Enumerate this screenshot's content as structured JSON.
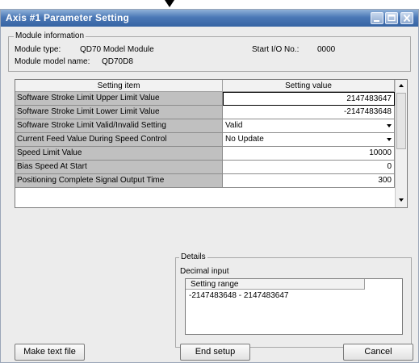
{
  "window": {
    "title": "Axis #1 Parameter Setting"
  },
  "module_info": {
    "legend": "Module information",
    "type_label": "Module type:",
    "type_value": "QD70 Model Module",
    "start_io_label": "Start I/O No.:",
    "start_io_value": "0000",
    "model_label": "Module model name:",
    "model_value": "QD70D8"
  },
  "grid": {
    "col_item": "Setting item",
    "col_value": "Setting value",
    "rows": [
      {
        "item": "Software Stroke Limit Upper Limit Value",
        "value": "2147483647"
      },
      {
        "item": "Software Stroke Limit Lower Limit Value",
        "value": "-2147483648"
      },
      {
        "item": "Software Stroke Limit Valid/Invalid Setting",
        "value": "Valid"
      },
      {
        "item": "Current Feed Value During Speed Control",
        "value": "No Update"
      },
      {
        "item": "Speed Limit Value",
        "value": "10000"
      },
      {
        "item": "Bias Speed At Start",
        "value": "0"
      },
      {
        "item": "Positioning Complete Signal Output Time",
        "value": "300"
      }
    ]
  },
  "details": {
    "legend": "Details",
    "input_type": "Decimal input",
    "range_header": "Setting range",
    "range_value": "-2147483648 - 2147483647"
  },
  "buttons": {
    "make_text": "Make text file",
    "end_setup": "End setup",
    "cancel": "Cancel"
  },
  "icons": {
    "minimize": "minimize-icon",
    "maximize": "maximize-icon",
    "close": "close-icon",
    "dropdown": "chevron-down-icon"
  }
}
